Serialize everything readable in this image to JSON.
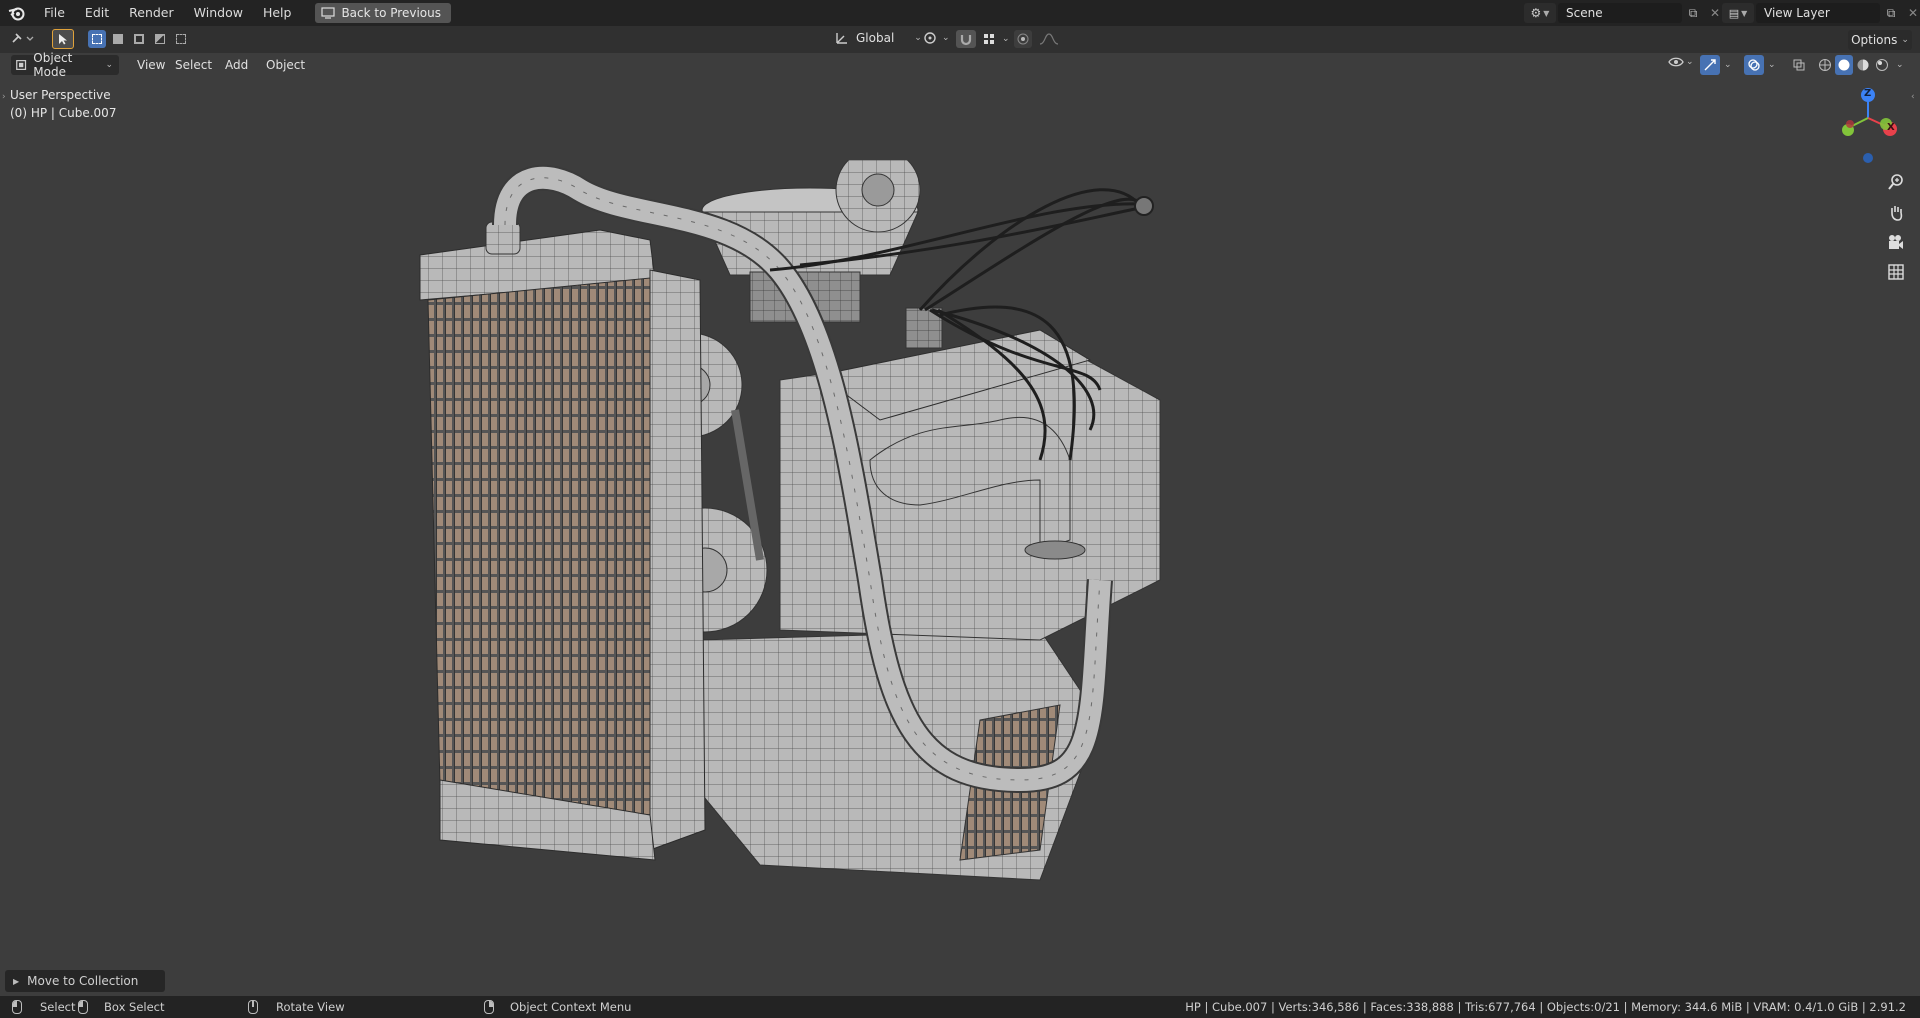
{
  "topbar": {
    "menus": [
      "File",
      "Edit",
      "Render",
      "Window",
      "Help"
    ],
    "back_button": "Back to Previous",
    "scene_label": "Scene",
    "view_layer_label": "View Layer"
  },
  "toolbar": {
    "transform_orientation": "Global",
    "options_label": "Options"
  },
  "viewport_header": {
    "mode": "Object Mode",
    "menus": [
      "View",
      "Select",
      "Add",
      "Object"
    ]
  },
  "viewport": {
    "perspective_label": "User Perspective",
    "object_label": "(0) HP | Cube.007"
  },
  "gizmo": {
    "axes": [
      "Z",
      "X",
      "Y"
    ],
    "colors": {
      "x": "#e8414b",
      "y": "#82c43a",
      "z": "#3b82f6"
    }
  },
  "operator_panel": {
    "label": "Move to Collection"
  },
  "statusbar": {
    "select": "Select",
    "box_select": "Box Select",
    "rotate_view": "Rotate View",
    "context_menu": "Object Context Menu",
    "stats": "HP | Cube.007 | Verts:346,586 | Faces:338,888 | Tris:677,764 | Objects:0/21 | Memory: 344.6 MiB | VRAM: 0.4/1.0 GiB | 2.91.2"
  }
}
